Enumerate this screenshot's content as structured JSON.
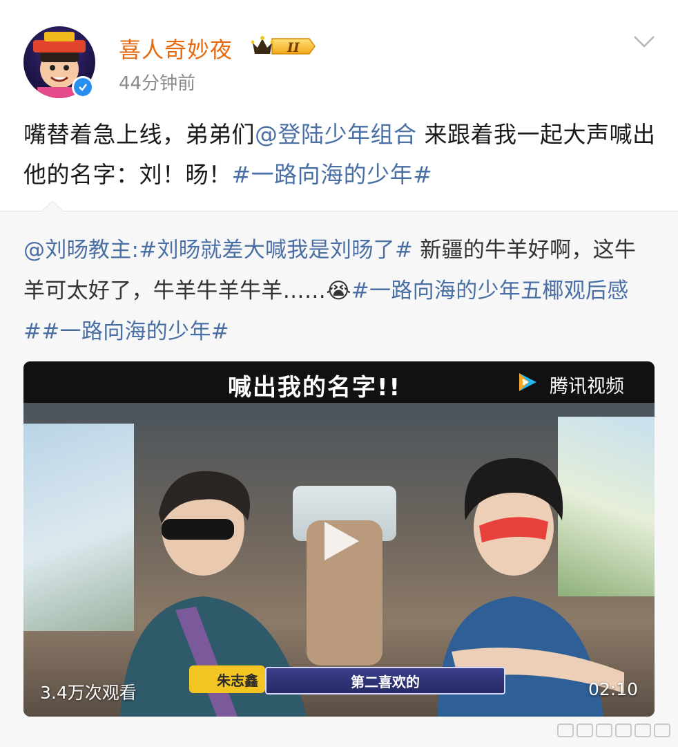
{
  "post": {
    "username": "喜人奇妙夜",
    "timestamp": "44分钟前",
    "text_before_mention": "嘴替着急上线，弟弟们",
    "mention": "@登陆少年组合",
    "text_after_mention": " 来跟着我一起大声喊出他的名字：刘！旸！",
    "hashtag": "#一路向海的少年#"
  },
  "repost": {
    "author": "@刘旸教主",
    "colon": ":",
    "hashtag1": "#刘旸就差大喊我是刘旸了#",
    "text": " 新疆的牛羊好啊，这牛羊可太好了，牛羊牛羊牛羊……",
    "emoji": "😭",
    "hashtag2": "#一路向海的少年五椰观后感#",
    "hashtag3": "#一路向海的少年#"
  },
  "video": {
    "title": "喊出我的名字!!",
    "platform": "腾讯视频",
    "name_tag": "朱志鑫",
    "caption": "第二喜欢的",
    "views": "3.4万次观看",
    "duration": "02:10"
  },
  "colors": {
    "username": "#e86a0f",
    "link": "#4a6fa5",
    "verified": "#2a8df0"
  },
  "icons": [
    "verified-icon",
    "vip-crown-badge-icon",
    "chevron-down-icon",
    "play-icon",
    "tencent-video-logo-icon",
    "crying-emoji-icon"
  ]
}
